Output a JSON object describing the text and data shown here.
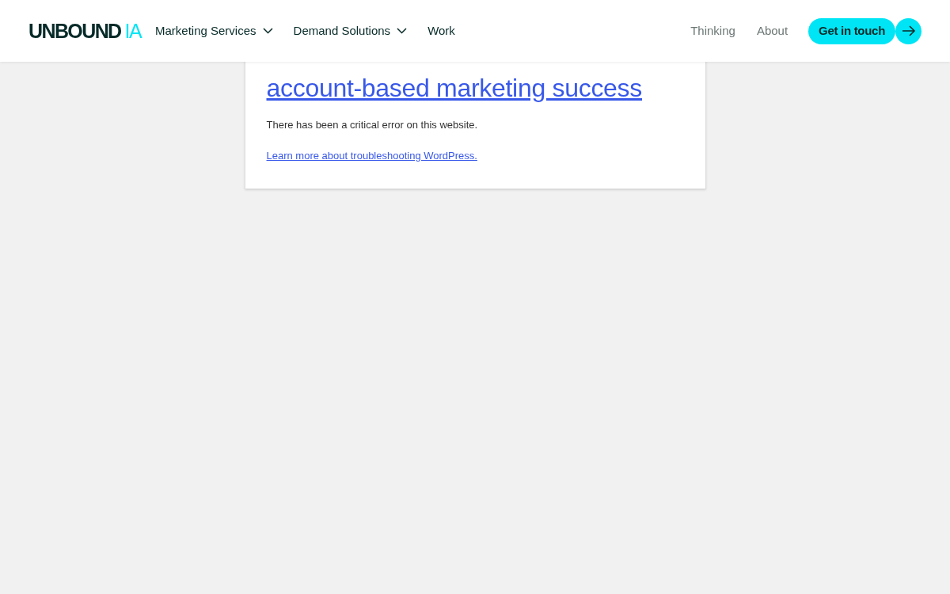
{
  "header": {
    "logo": {
      "main": "UNBOUND",
      "accent": "IA"
    },
    "nav": [
      {
        "label": "Marketing Services",
        "dropdown": true
      },
      {
        "label": "Demand Solutions",
        "dropdown": true
      },
      {
        "label": "Work",
        "dropdown": false
      }
    ],
    "secondary_nav": [
      "Thinking",
      "About"
    ],
    "cta": {
      "label": "Get in touch"
    }
  },
  "error_card": {
    "title": "account-based marketing success",
    "message": "There has been a critical error on this website.",
    "link": "Learn more about troubleshooting WordPress."
  }
}
